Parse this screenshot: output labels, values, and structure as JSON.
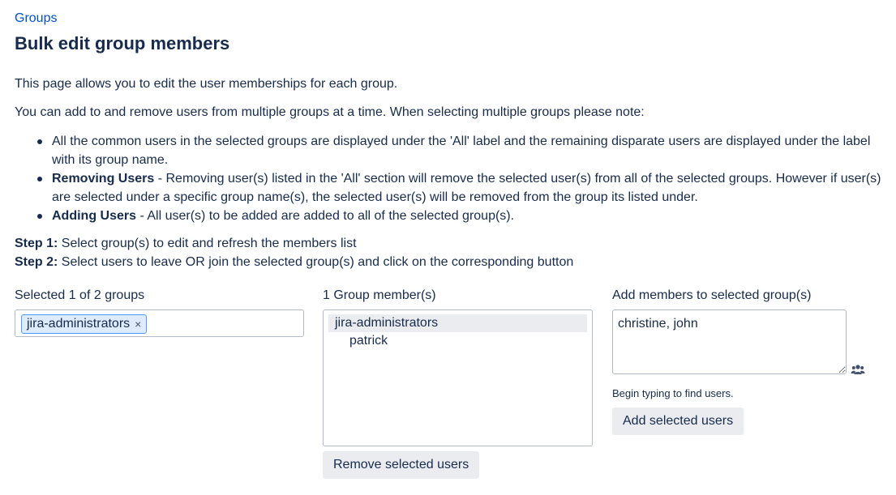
{
  "breadcrumb": "Groups",
  "page_title": "Bulk edit group members",
  "intro": "This page allows you to edit the user memberships for each group.",
  "note": "You can add to and remove users from multiple groups at a time. When selecting multiple groups please note:",
  "bullets": [
    {
      "bold": "",
      "text": "All the common users in the selected groups are displayed under the 'All' label and the remaining disparate users are displayed under the label with its group name."
    },
    {
      "bold": "Removing Users",
      "text": " - Removing user(s) listed in the 'All' section will remove the selected user(s) from all of the selected groups. However if user(s) are selected under a specific group name(s), the selected user(s) will be removed from the group its listed under."
    },
    {
      "bold": "Adding Users",
      "text": " - All user(s) to be added are added to all of the selected group(s)."
    }
  ],
  "steps": [
    {
      "bold": "Step 1:",
      "text": " Select group(s) to edit and refresh the members list"
    },
    {
      "bold": "Step 2:",
      "text": " Select users to leave OR join the selected group(s) and click on the corresponding button"
    }
  ],
  "groups_panel": {
    "label": "Selected 1 of 2 groups",
    "selected_chip": "jira-administrators",
    "chip_remove": "×"
  },
  "members_panel": {
    "label": "1 Group member(s)",
    "group_name": "jira-administrators",
    "members": [
      "patrick"
    ],
    "remove_button": "Remove selected users"
  },
  "add_panel": {
    "label": "Add members to selected group(s)",
    "input_value": "christine, john",
    "hint": "Begin typing to find users.",
    "add_button": "Add selected users",
    "picker_icon": "users-icon"
  }
}
